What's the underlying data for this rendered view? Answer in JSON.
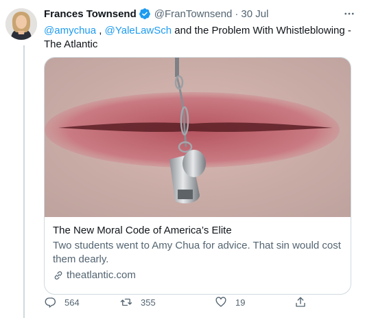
{
  "tweet": {
    "author_name": "Frances Townsend",
    "handle": "@FranTownsend",
    "separator": "·",
    "time": "30 Jul",
    "verified_icon": "verified-badge-icon",
    "more_icon": "more-horizontal-icon",
    "mention_1": "@amychua",
    "comma": " ,",
    "mention_2": "@YaleLawSch",
    "text_rest": " and the Problem With Whistleblowing - The Atlantic"
  },
  "card": {
    "image_icon": "lips-with-whistle-image",
    "title": "The New Moral Code of America’s Elite",
    "description": "Two students went to Amy Chua for advice. That sin would cost them dearly.",
    "domain_icon": "link-icon",
    "domain": "theatlantic.com"
  },
  "actions": {
    "reply_icon": "reply-icon",
    "reply_count": "564",
    "retweet_icon": "retweet-icon",
    "retweet_count": "355",
    "like_icon": "like-icon",
    "like_count": "19",
    "share_icon": "share-icon"
  },
  "colors": {
    "accent": "#1d9bf0",
    "text_primary": "#0f1419",
    "text_secondary": "#536471",
    "border": "#cfd9de"
  }
}
